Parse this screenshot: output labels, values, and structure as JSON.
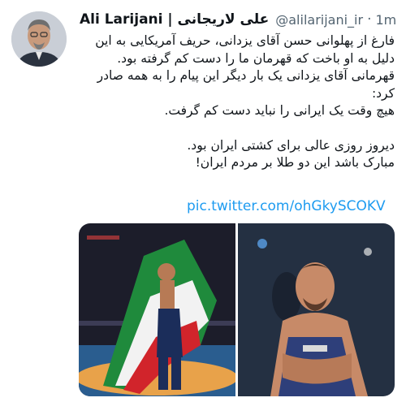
{
  "tweet": {
    "author_name": "Ali Larijani | علی لاریجانی",
    "handle": "@alilarijani_ir",
    "separator": "·",
    "time": "1m",
    "paragraphs": [
      "فارغ از پهلوانی حسن آقای یزدانی، حریف آمریکایی به این دلیل به او باخت که قهرمان ما را دست کم گرفته بود.",
      "قهرمانی آقای یزدانی یک بار دیگر این پیام را به همه صادر کرد:",
      "هیچ وقت یک ایرانی را نباید دست کم گرفت."
    ],
    "closing_lines": [
      "دیروز روزی عالی برای کشتی ایران بود.",
      "مبارک باشد این دو طلا بر مردم ایران!"
    ],
    "link": "pic.twitter.com/ohGkySCOKV"
  },
  "icons": {
    "avatar": "profile-photo",
    "photo_left": "wrestler-with-flag-photo",
    "photo_right": "wrestler-portrait-photo"
  },
  "colors": {
    "link": "#1d9bf0",
    "secondary_text": "#536471",
    "primary_text": "#0f1419"
  }
}
